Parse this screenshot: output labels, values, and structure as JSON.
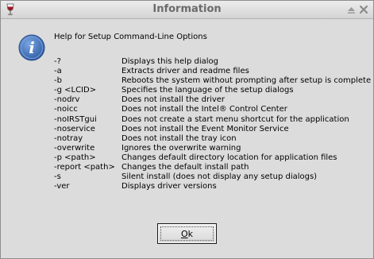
{
  "window": {
    "title": "Information"
  },
  "dialog": {
    "heading": "Help for Setup Command-Line Options",
    "options": [
      {
        "flag": "-?",
        "desc": "Displays this help dialog"
      },
      {
        "flag": "-a",
        "desc": "Extracts driver and readme files"
      },
      {
        "flag": "-b",
        "desc": "Reboots the system without prompting after setup is complete"
      },
      {
        "flag": "-g <LCID>",
        "desc": "Specifies the language of the setup dialogs"
      },
      {
        "flag": "-nodrv",
        "desc": "Does not install the driver"
      },
      {
        "flag": "-noicc",
        "desc": "Does not install the Intel® Control Center"
      },
      {
        "flag": "-noIRSTgui",
        "desc": "Does not create a start menu shortcut for the application"
      },
      {
        "flag": "-noservice",
        "desc": "Does not install the Event Monitor Service"
      },
      {
        "flag": "-notray",
        "desc": "Does not install the tray icon"
      },
      {
        "flag": "-overwrite",
        "desc": "Ignores the overwrite warning"
      },
      {
        "flag": "-p <path>",
        "desc": "Changes default directory location for application files"
      },
      {
        "flag": "-report <path>",
        "desc": "Changes the default install path"
      },
      {
        "flag": "-s",
        "desc": "Silent install (does not display any setup dialogs)"
      },
      {
        "flag": "-ver",
        "desc": "Displays driver versions"
      }
    ],
    "ok_mnemonic": "O",
    "ok_rest": "k"
  },
  "icons": {
    "app": "wine-glass-icon",
    "shade": "shade-icon",
    "close": "close-icon",
    "info": "info-icon"
  },
  "colors": {
    "info_icon": "#3a6bb5",
    "title_text": "#6a6a6a"
  }
}
